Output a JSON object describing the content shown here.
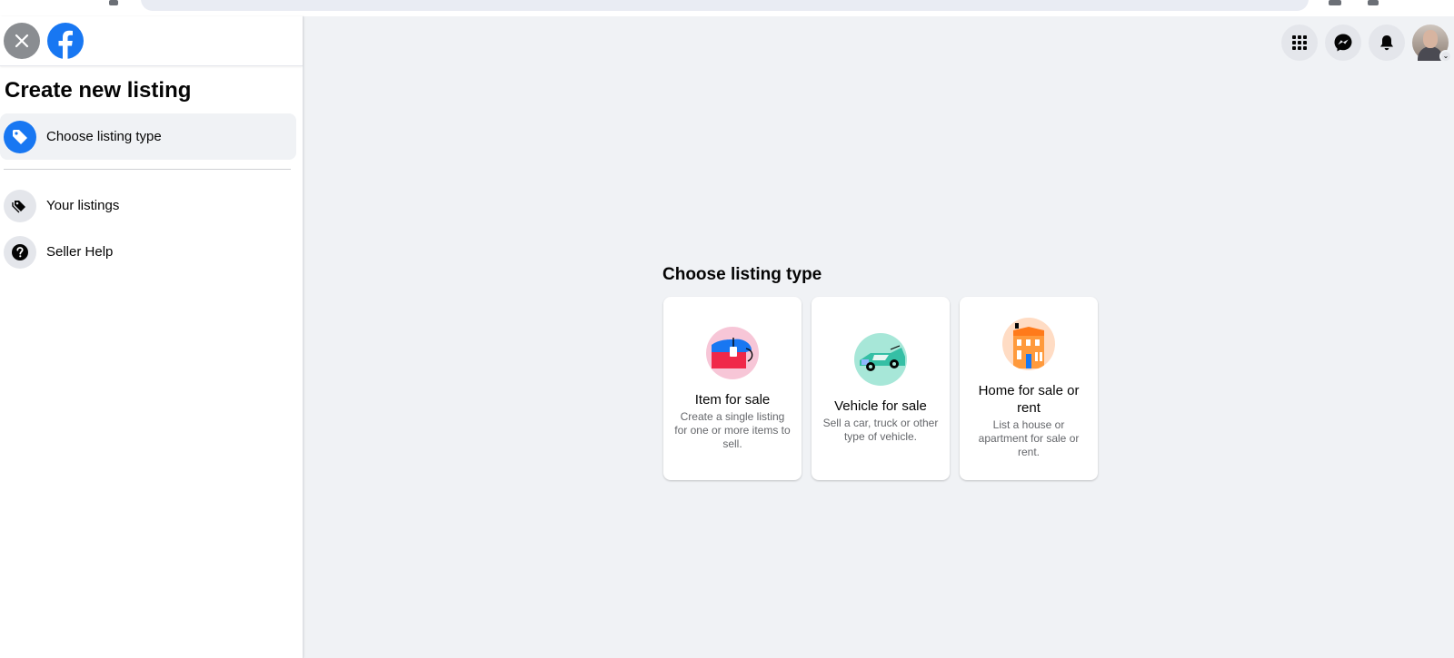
{
  "sidebar": {
    "title": "Create new listing",
    "items": [
      {
        "label": "Choose listing type",
        "icon": "tag-icon",
        "active": true
      },
      {
        "label": "Your listings",
        "icon": "tags-icon",
        "active": false
      },
      {
        "label": "Seller Help",
        "icon": "question-icon",
        "active": false
      }
    ]
  },
  "main": {
    "title": "Choose listing type",
    "cards": [
      {
        "title": "Item for sale",
        "description": "Create a single listing for one or more items to sell.",
        "icon": "item-illustration-icon"
      },
      {
        "title": "Vehicle for sale",
        "description": "Sell a car, truck or other type of vehicle.",
        "icon": "vehicle-illustration-icon"
      },
      {
        "title": "Home for sale or rent",
        "description": "List a house or apartment for sale or rent.",
        "icon": "house-illustration-icon"
      }
    ]
  },
  "top_nav": [
    "menu-grid-icon",
    "messenger-icon",
    "notifications-bell-icon",
    "account-avatar"
  ],
  "colors": {
    "accent": "#1877f2",
    "background": "#f0f2f5",
    "secondary_text": "#65676b"
  }
}
